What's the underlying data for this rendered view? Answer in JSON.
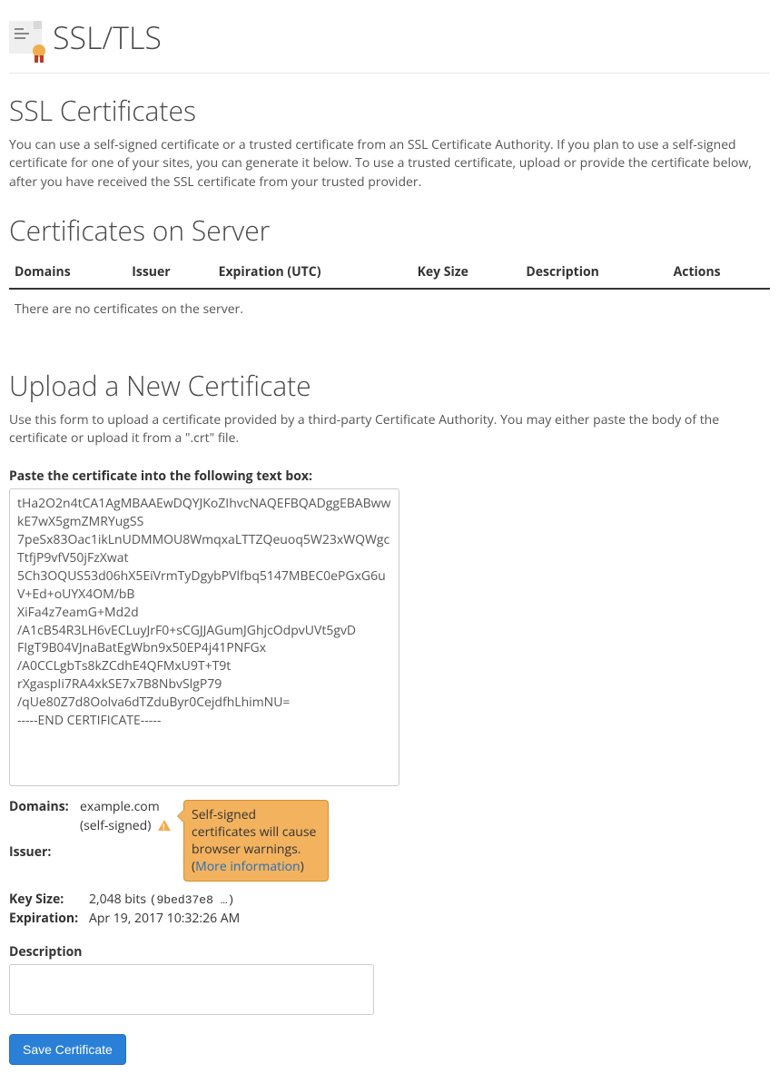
{
  "header": {
    "title": "SSL/TLS",
    "icon": "ssl-certificate-icon"
  },
  "section1": {
    "title": "SSL Certificates",
    "desc": "You can use a self-signed certificate or a trusted certificate from an SSL Certificate Authority. If you plan to use a self-signed certificate for one of your sites, you can generate it below. To use a trusted certificate, upload or provide the certificate below, after you have received the SSL certificate from your trusted provider."
  },
  "section2": {
    "title": "Certificates on Server",
    "columns": {
      "domains": "Domains",
      "issuer": "Issuer",
      "expiration": "Expiration (UTC)",
      "keysize": "Key Size",
      "description": "Description",
      "actions": "Actions"
    },
    "empty_msg": "There are no certificates on the server."
  },
  "section3": {
    "title": "Upload a New Certificate",
    "desc": "Use this form to upload a certificate provided by a third-party Certificate Authority. You may either paste the body of the certificate or upload it from a \".crt\" file.",
    "paste_label": "Paste the certificate into the following text box:",
    "paste_value": "tHa2O2n4tCA1AgMBAAEwDQYJKoZIhvcNAQEFBQADggEBABwwkE7wX5gmZMRYugSS\n7peSx83Oac1ikLnUDMMOU8WmqxaLTTZQeuoq5W23xWQWgcTtfjP9vfV50jFzXwat\n5Ch3OQUS53d06hX5EiVrmTyDgybPVlfbq5147MBEC0ePGxG6uV+Ed+oUYX4OM/bB\nXiFa4z7eamG+Md2d\n/A1cB54R3LH6vECLuyJrF0+sCGJJAGumJGhjcOdpvUVt5gvD\nFIgT9B04VJnaBatEgWbn9x50EP4j41PNFGx\n/A0CCLgbTs8kZCdhE4QFMxU9T+T9t\nrXgaspIi7RA4xkSE7x7B8NbvSlgP79\n/qUe80Z7d8Oolva6dTZduByr0CejdfhLhimNU=\n-----END CERTIFICATE-----"
  },
  "parsed": {
    "labels": {
      "domains": "Domains:",
      "issuer": "Issuer:",
      "key_size": "Key Size:",
      "expiration": "Expiration:"
    },
    "domain": "example.com",
    "self_signed": "(self-signed)",
    "tooltip_text": "Self-signed certificates will cause browser warnings. (",
    "tooltip_link": "More information",
    "tooltip_close": ")",
    "key_size_value": "2,048 bits ",
    "key_size_hash": "(9bed37e8 …)",
    "expiration_value": "Apr 19, 2017 10:32:26 AM"
  },
  "description": {
    "label": "Description",
    "value": ""
  },
  "button": {
    "save": "Save Certificate"
  }
}
